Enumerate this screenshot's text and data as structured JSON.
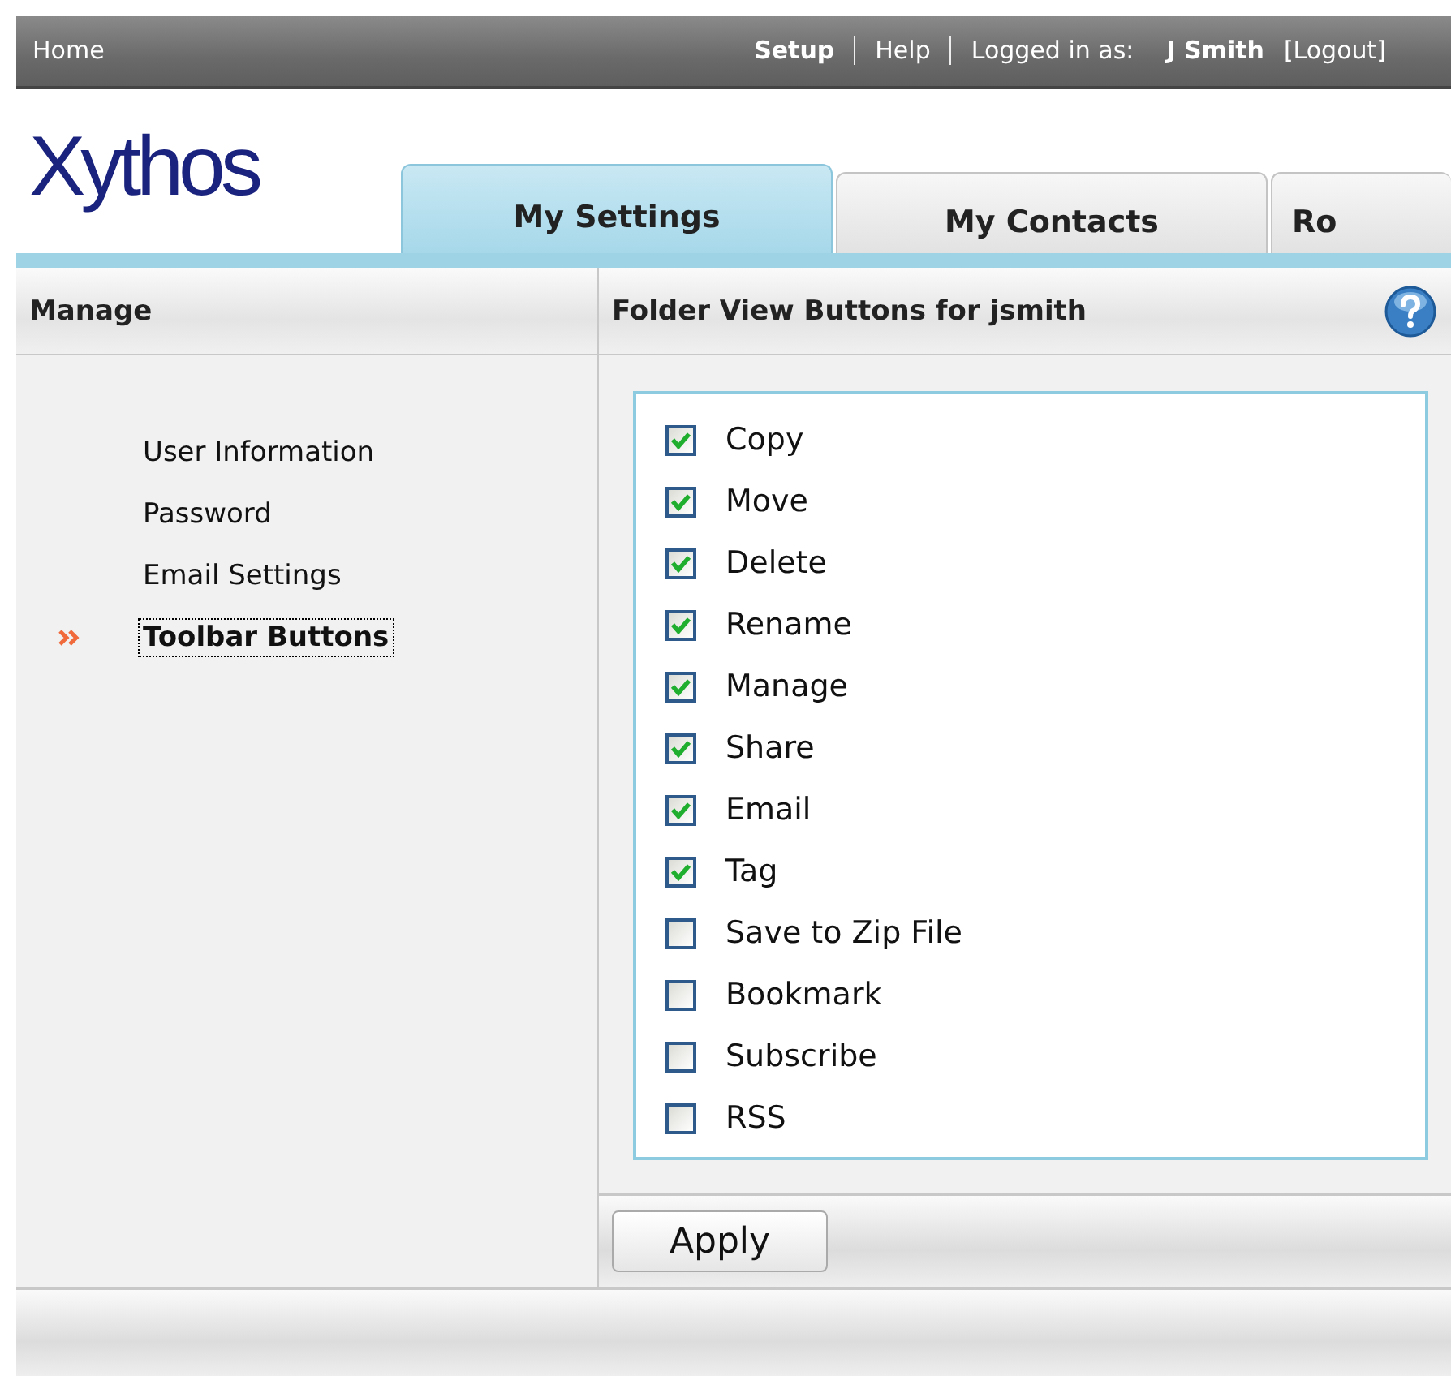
{
  "top_bar": {
    "home": "Home",
    "items": [
      {
        "kind": "strong-link",
        "text": "Setup"
      },
      {
        "kind": "separator"
      },
      {
        "kind": "link",
        "text": "Help"
      },
      {
        "kind": "separator"
      },
      {
        "kind": "label",
        "text": "Logged in as:"
      },
      {
        "kind": "user",
        "text": "J Smith"
      },
      {
        "kind": "link",
        "text": "[Logout]"
      }
    ]
  },
  "logo": "Xythos",
  "tabs": [
    {
      "label": "My Settings",
      "selected": true
    },
    {
      "label": "My Contacts",
      "selected": false
    },
    {
      "label": "Ro",
      "selected": false
    }
  ],
  "sidebar": {
    "title": "Manage",
    "items": [
      {
        "label": "User Information",
        "selected": false
      },
      {
        "label": "Password",
        "selected": false
      },
      {
        "label": "Email Settings",
        "selected": false
      },
      {
        "label": "Toolbar Buttons",
        "selected": true
      }
    ]
  },
  "main": {
    "title": "Folder View Buttons for jsmith",
    "options": [
      {
        "label": "Copy",
        "checked": true
      },
      {
        "label": "Move",
        "checked": true
      },
      {
        "label": "Delete",
        "checked": true
      },
      {
        "label": "Rename",
        "checked": true
      },
      {
        "label": "Manage",
        "checked": true
      },
      {
        "label": "Share",
        "checked": true
      },
      {
        "label": "Email",
        "checked": true
      },
      {
        "label": "Tag",
        "checked": true
      },
      {
        "label": "Save to Zip File",
        "checked": false
      },
      {
        "label": "Bookmark",
        "checked": false
      },
      {
        "label": "Subscribe",
        "checked": false
      },
      {
        "label": "RSS",
        "checked": false
      }
    ],
    "apply": "Apply"
  }
}
